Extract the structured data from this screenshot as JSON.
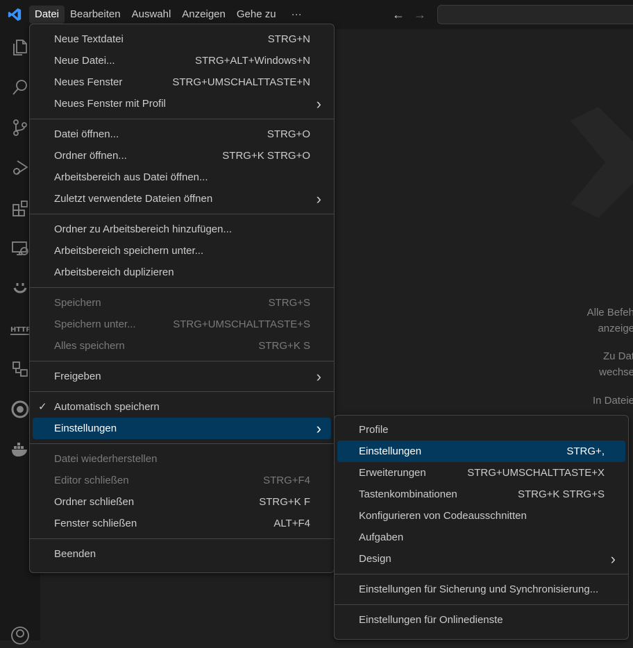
{
  "menubar": {
    "items": [
      "Datei",
      "Bearbeiten",
      "Auswahl",
      "Anzeigen",
      "Gehe zu"
    ],
    "more": "···"
  },
  "file_menu": {
    "groups": [
      [
        {
          "label": "Neue Textdatei",
          "shortcut": "STRG+N"
        },
        {
          "label": "Neue Datei...",
          "shortcut": "STRG+ALT+Windows+N"
        },
        {
          "label": "Neues Fenster",
          "shortcut": "STRG+UMSCHALTTASTE+N"
        },
        {
          "label": "Neues Fenster mit Profil",
          "submenu": true
        }
      ],
      [
        {
          "label": "Datei öffnen...",
          "shortcut": "STRG+O"
        },
        {
          "label": "Ordner öffnen...",
          "shortcut": "STRG+K STRG+O"
        },
        {
          "label": "Arbeitsbereich aus Datei öffnen..."
        },
        {
          "label": "Zuletzt verwendete Dateien öffnen",
          "submenu": true
        }
      ],
      [
        {
          "label": "Ordner zu Arbeitsbereich hinzufügen..."
        },
        {
          "label": "Arbeitsbereich speichern unter..."
        },
        {
          "label": "Arbeitsbereich duplizieren"
        }
      ],
      [
        {
          "label": "Speichern",
          "shortcut": "STRG+S",
          "disabled": true
        },
        {
          "label": "Speichern unter...",
          "shortcut": "STRG+UMSCHALTTASTE+S",
          "disabled": true
        },
        {
          "label": "Alles speichern",
          "shortcut": "STRG+K S",
          "disabled": true
        }
      ],
      [
        {
          "label": "Freigeben",
          "submenu": true
        }
      ],
      [
        {
          "label": "Automatisch speichern",
          "checked": true
        },
        {
          "label": "Einstellungen",
          "submenu": true,
          "highlighted": true
        }
      ],
      [
        {
          "label": "Datei wiederherstellen",
          "disabled": true
        },
        {
          "label": "Editor schließen",
          "shortcut": "STRG+F4",
          "disabled": true
        },
        {
          "label": "Ordner schließen",
          "shortcut": "STRG+K F"
        },
        {
          "label": "Fenster schließen",
          "shortcut": "ALT+F4"
        }
      ],
      [
        {
          "label": "Beenden"
        }
      ]
    ]
  },
  "settings_submenu": {
    "groups": [
      [
        {
          "label": "Profile"
        },
        {
          "label": "Einstellungen",
          "shortcut": "STRG+,",
          "highlighted": true
        },
        {
          "label": "Erweiterungen",
          "shortcut": "STRG+UMSCHALTTASTE+X"
        },
        {
          "label": "Tastenkombinationen",
          "shortcut": "STRG+K STRG+S"
        },
        {
          "label": "Konfigurieren von Codeausschnitten"
        },
        {
          "label": "Aufgaben"
        },
        {
          "label": "Design",
          "submenu": true
        }
      ],
      [
        {
          "label": "Einstellungen für Sicherung und Synchronisierung..."
        }
      ],
      [
        {
          "label": "Einstellungen für Onlinedienste"
        }
      ]
    ]
  },
  "editor_hints": [
    "Alle Befeh",
    "anzeige",
    "Zu Dat",
    "wechse",
    "In Dateie"
  ],
  "activity_icons": [
    "explorer-icon",
    "search-icon",
    "source-control-icon",
    "run-debug-icon",
    "extensions-icon",
    "remote-explorer-icon",
    "copilot-icon",
    "http-icon",
    "database-icon",
    "testing-icon",
    "docker-icon",
    "account-icon"
  ],
  "colors": {
    "highlight": "#04395e",
    "background": "#1f1f1f",
    "brand": "#3794ff"
  }
}
